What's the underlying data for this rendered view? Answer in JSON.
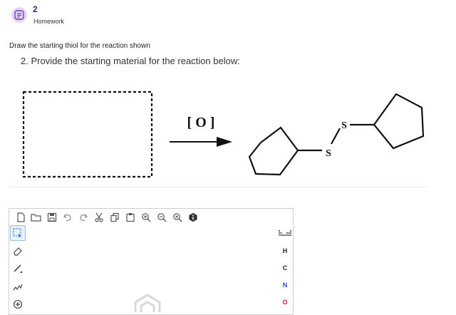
{
  "header": {
    "number": "2",
    "label": "Homework"
  },
  "instructions": "Draw the starting thiol for the reaction shown",
  "question": "2. Provide the starting material for the reaction below:",
  "reaction": {
    "reagent": "[ O ]",
    "product_atom_1": "S",
    "product_atom_2": "S"
  },
  "editor": {
    "toolbar_icons": [
      "new-document-icon",
      "open-folder-icon",
      "save-icon",
      "undo-icon",
      "redo-icon",
      "cut-icon",
      "copy-icon",
      "paste-icon",
      "zoom-in-icon",
      "zoom-out-icon",
      "zoom-reset-icon",
      "info-icon"
    ],
    "left_tools": [
      "select-tool-icon",
      "eraser-icon",
      "bond-tool-icon",
      "chain-tool-icon",
      "charge-plus-icon"
    ],
    "periodic_table_label": "periodic-table-icon",
    "elements": [
      "H",
      "C",
      "N",
      "O"
    ],
    "element_colors": {
      "H": "#222222",
      "C": "#222222",
      "N": "#1f4fd1",
      "O": "#d1231f"
    }
  },
  "colors": {
    "accent": "#6a3fb0",
    "icon_bg": "#e6d8f5",
    "header_number": "#2b2b6e"
  }
}
